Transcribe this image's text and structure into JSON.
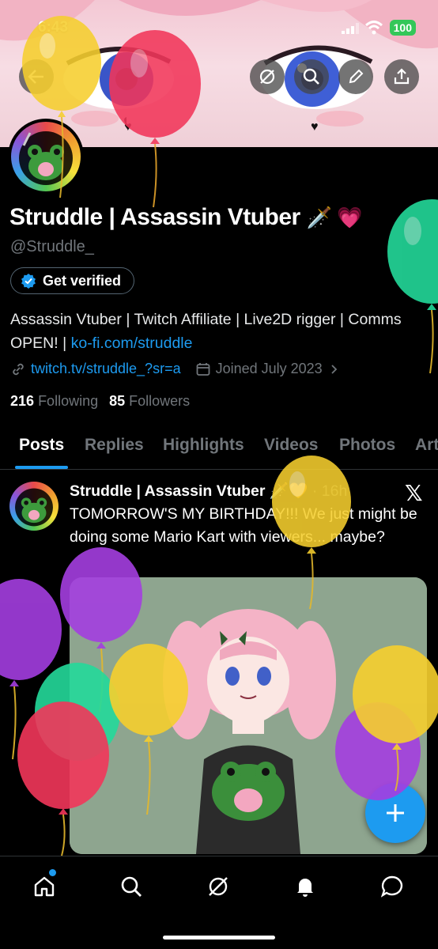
{
  "status_bar": {
    "time": "6:43",
    "battery": "100"
  },
  "profile": {
    "display_name": "Struddle | Assassin Vtuber",
    "name_emoji": "🗡️ 💗",
    "handle": "@Struddle_",
    "verify_button": "Get verified",
    "bio_text": "Assassin Vtuber | Twitch Affiliate | Live2D rigger | Comms OPEN! | ",
    "bio_link": "ko-fi.com/struddle",
    "website": "twitch.tv/struddle_?sr=a",
    "joined": "Joined July 2023",
    "following_count": "216",
    "following_label": "Following",
    "followers_count": "85",
    "followers_label": "Followers"
  },
  "tabs": [
    "Posts",
    "Replies",
    "Highlights",
    "Videos",
    "Photos",
    "Art"
  ],
  "post": {
    "author": "Struddle | Assassin Vtuber",
    "author_emoji": "🗡️🧡",
    "time": "· 16h",
    "text": "TOMORROW'S MY BIRTHDAY!!! We just might be doing some Mario Kart with viewers... maybe?"
  },
  "icons": {
    "back": "back-arrow-icon",
    "grok": "grok-icon",
    "search": "search-icon",
    "edit": "pencil-icon",
    "share": "share-icon",
    "link": "link-icon",
    "calendar": "calendar-icon",
    "verified": "verified-badge-icon",
    "x": "x-logo-icon",
    "compose": "plus-icon",
    "nav": [
      "home-icon",
      "search-icon",
      "grok-icon",
      "bell-icon",
      "messages-icon"
    ]
  },
  "colors": {
    "accent": "#1d9bf0",
    "background": "#000000",
    "muted": "#71767b",
    "balloon_red": "#f2365a",
    "balloon_yellow": "#f6cf2e",
    "balloon_green": "#23d99a",
    "balloon_purple": "#a43ee0"
  }
}
